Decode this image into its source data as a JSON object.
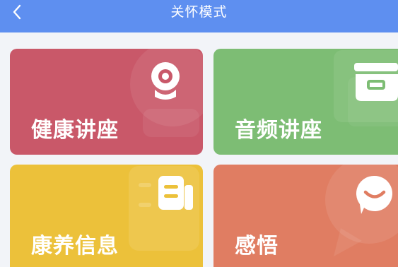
{
  "header": {
    "title": "关怀模式",
    "background": "#5e8ff0",
    "back_icon": "chevron-left-icon"
  },
  "cards": [
    {
      "id": "health-lecture",
      "label": "健康讲座",
      "color": "#c95869",
      "icon": "webcam-icon"
    },
    {
      "id": "audio-lecture",
      "label": "音频讲座",
      "color": "#7dbd74",
      "icon": "archive-box-icon"
    },
    {
      "id": "wellness-info",
      "label": "康养信息",
      "color": "#ecc13a",
      "icon": "document-icon"
    },
    {
      "id": "reflections",
      "label": "感悟",
      "color": "#e07d62",
      "icon": "smile-chat-icon"
    }
  ]
}
